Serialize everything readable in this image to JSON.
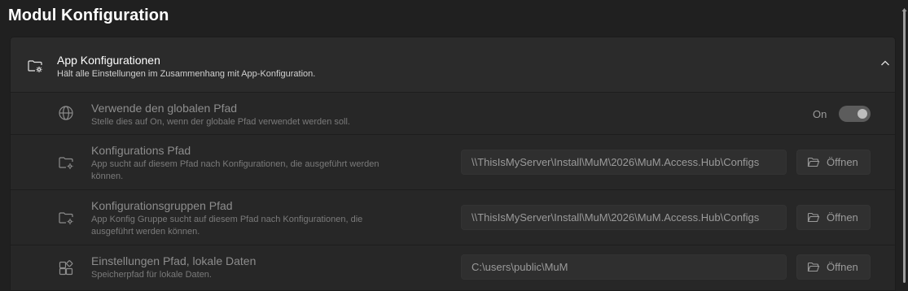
{
  "page": {
    "title": "Modul Konfiguration"
  },
  "section": {
    "title": "App Konfigurationen",
    "subtitle": "Hält alle Einstellungen im Zusammenhang mit App-Konfiguration.",
    "icon": "folder-settings-icon",
    "expanded": true
  },
  "settings": [
    {
      "icon": "globe-icon",
      "title": "Verwende den globalen Pfad",
      "subtitle": "Stelle dies auf On, wenn der globale Pfad verwendet werden soll.",
      "toggle_state": "On",
      "toggle_on": true
    },
    {
      "icon": "folder-settings-icon",
      "title": "Konfigurations Pfad",
      "subtitle_line1": "App sucht auf diesem Pfad nach Konfigurationen, die ausgeführt werden",
      "subtitle_line2": "können.",
      "value": "\\\\ThisIsMyServer\\Install\\MuM\\2026\\MuM.Access.Hub\\Configs",
      "button_label": "Öffnen",
      "button_icon": "folder-open-icon"
    },
    {
      "icon": "folder-settings-icon",
      "title": "Konfigurationsgruppen Pfad",
      "subtitle_line1": "App Konfig Gruppe sucht auf diesem Pfad nach Konfigurationen, die",
      "subtitle_line2": "ausgeführt werden können.",
      "value": "\\\\ThisIsMyServer\\Install\\MuM\\2026\\MuM.Access.Hub\\Configs",
      "button_label": "Öffnen",
      "button_icon": "folder-open-icon"
    },
    {
      "icon": "apps-add-icon",
      "title": "Einstellungen Pfad, lokale Daten",
      "subtitle": "Speicherpfad für lokale Daten.",
      "value": "C:\\users\\public\\MuM",
      "button_label": "Öffnen",
      "button_icon": "folder-open-icon"
    }
  ],
  "colors": {
    "background": "#202020",
    "card": "#2b2b2b",
    "row": "#272727",
    "dim_text": "#8d8d8d"
  }
}
